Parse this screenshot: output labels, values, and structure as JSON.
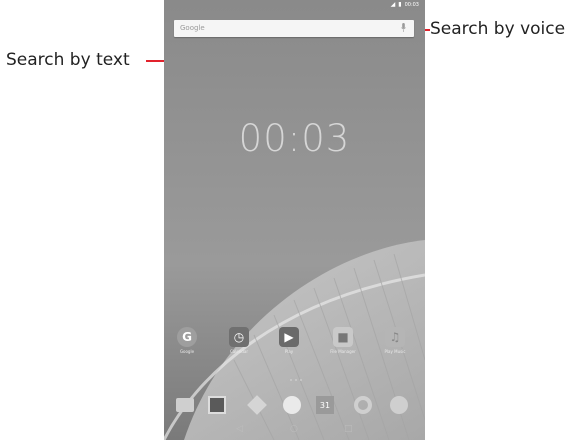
{
  "callouts": {
    "search_text": "Search by text",
    "search_voice": "Search by voice"
  },
  "status_bar": {
    "time": "00:03",
    "icons": [
      "signal-icon",
      "battery-icon"
    ]
  },
  "search_bar": {
    "placeholder": "Google"
  },
  "home_clock": "00:03",
  "home_apps": [
    {
      "icon": "google-app-icon",
      "label": "Google"
    },
    {
      "icon": "alarm-clock-icon",
      "label": "Calendar"
    },
    {
      "icon": "play-store-icon",
      "label": "Play"
    },
    {
      "icon": "file-manager-icon",
      "label": "File Manager"
    },
    {
      "icon": "play-music-icon",
      "label": "Play Music"
    }
  ],
  "dock_apps": [
    {
      "icon": "contacts-icon"
    },
    {
      "icon": "gallery-icon"
    },
    {
      "icon": "messages-icon"
    },
    {
      "icon": "app-drawer-icon"
    },
    {
      "icon": "calendar-icon",
      "text": "31"
    },
    {
      "icon": "chrome-icon"
    },
    {
      "icon": "camera-icon"
    }
  ],
  "nav_bar": [
    "back-icon",
    "home-icon",
    "recents-icon"
  ],
  "colors": {
    "callout_line": "#e2222c",
    "wallpaper": "#8f8f8f"
  }
}
